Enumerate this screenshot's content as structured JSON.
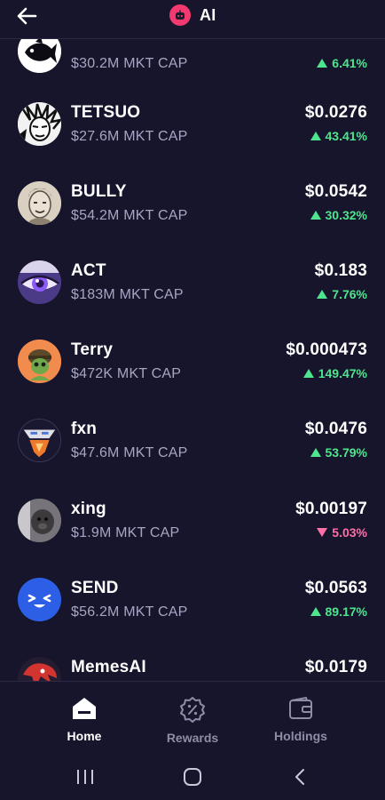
{
  "header": {
    "title": "AI",
    "back_icon": "arrow-left-icon",
    "category_icon": "robot-icon",
    "badge_color": "#f23a70"
  },
  "coins": [
    {
      "name": "",
      "mcap": "$30.2M MKT CAP",
      "price": "",
      "change": "6.41%",
      "direction": "up",
      "avatar": "fish-logo"
    },
    {
      "name": "TETSUO",
      "mcap": "$27.6M MKT CAP",
      "price": "$0.0276",
      "change": "43.41%",
      "direction": "up",
      "avatar": "manga-face"
    },
    {
      "name": "BULLY",
      "mcap": "$54.2M MKT CAP",
      "price": "$0.0542",
      "change": "30.32%",
      "direction": "up",
      "avatar": "sketch-portrait"
    },
    {
      "name": "ACT",
      "mcap": "$183M MKT CAP",
      "price": "$0.183",
      "change": "7.76%",
      "direction": "up",
      "avatar": "purple-eye"
    },
    {
      "name": "Terry",
      "mcap": "$472K MKT CAP",
      "price": "$0.000473",
      "change": "149.47%",
      "direction": "up",
      "avatar": "cartoon-turtle"
    },
    {
      "name": "fxn",
      "mcap": "$47.6M MKT CAP",
      "price": "$0.0476",
      "change": "53.79%",
      "direction": "up",
      "avatar": "fxn-logo"
    },
    {
      "name": "xing",
      "mcap": "$1.9M MKT CAP",
      "price": "$0.00197",
      "change": "5.03%",
      "direction": "down",
      "avatar": "blurry-photo"
    },
    {
      "name": "SEND",
      "mcap": "$56.2M MKT CAP",
      "price": "$0.0563",
      "change": "89.17%",
      "direction": "up",
      "avatar": "smiley-face"
    },
    {
      "name": "MemesAI",
      "mcap": "",
      "price": "$0.0179",
      "change": "",
      "direction": "up",
      "avatar": "red-creature"
    }
  ],
  "bottom_nav": [
    {
      "label": "Home",
      "icon": "home-icon",
      "active": true
    },
    {
      "label": "Rewards",
      "icon": "percent-badge-icon",
      "active": false
    },
    {
      "label": "Holdings",
      "icon": "wallet-icon",
      "active": false
    }
  ],
  "system_nav": [
    "recents-icon",
    "home-circle-icon",
    "back-chevron-icon"
  ],
  "colors": {
    "background": "#17152b",
    "up": "#4ee58f",
    "down": "#ff6fa8",
    "muted": "#a8a5c4"
  }
}
